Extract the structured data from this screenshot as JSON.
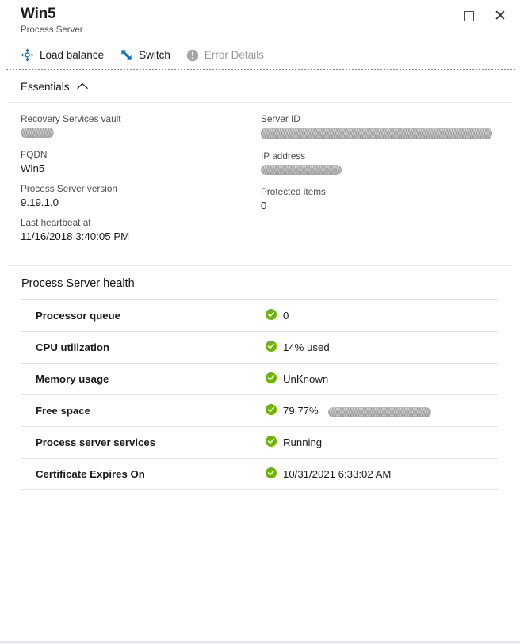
{
  "window": {
    "title": "Win5",
    "subtitle": "Process Server",
    "controls": [
      {
        "name": "restore-button",
        "glyph": "□"
      },
      {
        "name": "close-button",
        "glyph": "✕"
      }
    ]
  },
  "commandbar": {
    "items": [
      {
        "label": "Load balance",
        "icon": "load-balance-icon",
        "disabled": false
      },
      {
        "label": "Switch",
        "icon": "switch-icon",
        "disabled": false
      },
      {
        "label": "Error Details",
        "icon": "error-details-icon",
        "disabled": true
      }
    ]
  },
  "essentials": {
    "section_label": "Essentials",
    "chevron": "chevron-up-icon",
    "left_fields": [
      {
        "label": "Recovery Services vault",
        "value": "",
        "redacted": true,
        "redact_width": 42
      },
      {
        "label": "FQDN",
        "value": "Win5",
        "redacted": false
      },
      {
        "label": "Process Server version",
        "value": "9.19.1.0",
        "redacted": false
      },
      {
        "label": "Last heartbeat at",
        "value": "11/16/2018 3:40:05 PM",
        "redacted": false
      }
    ],
    "right_fields": [
      {
        "label": "Server ID",
        "value": "",
        "redacted": true,
        "redact_width": 292
      },
      {
        "label": "IP address",
        "value": "",
        "redacted": true,
        "redact_width": 102
      },
      {
        "label": "Protected items",
        "value": "0",
        "redacted": false
      }
    ]
  },
  "health": {
    "title": "Process Server health",
    "status_icon": "check-circle-icon",
    "status_color": "#6bb700",
    "rows": [
      {
        "label": "Processor queue",
        "value": "0",
        "status": "ok",
        "redacted": false
      },
      {
        "label": "CPU utilization",
        "value": "14% used",
        "status": "ok",
        "redacted": false
      },
      {
        "label": "Memory usage",
        "value": "UnKnown",
        "status": "ok",
        "redacted": false
      },
      {
        "label": "Free space",
        "value": "79.77%",
        "status": "ok",
        "redacted": true,
        "redact_width": 130
      },
      {
        "label": "Process server services",
        "value": "Running",
        "status": "ok",
        "redacted": false
      },
      {
        "label": "Certificate Expires On",
        "value": "10/31/2021 6:33:02 AM",
        "status": "ok",
        "redacted": false
      }
    ]
  },
  "theme": {
    "accent": "#0078d4",
    "success": "#6bb700",
    "disabled": "#9a9a9a",
    "text": "#1a1a1a",
    "rule": "#e2e2e2"
  }
}
